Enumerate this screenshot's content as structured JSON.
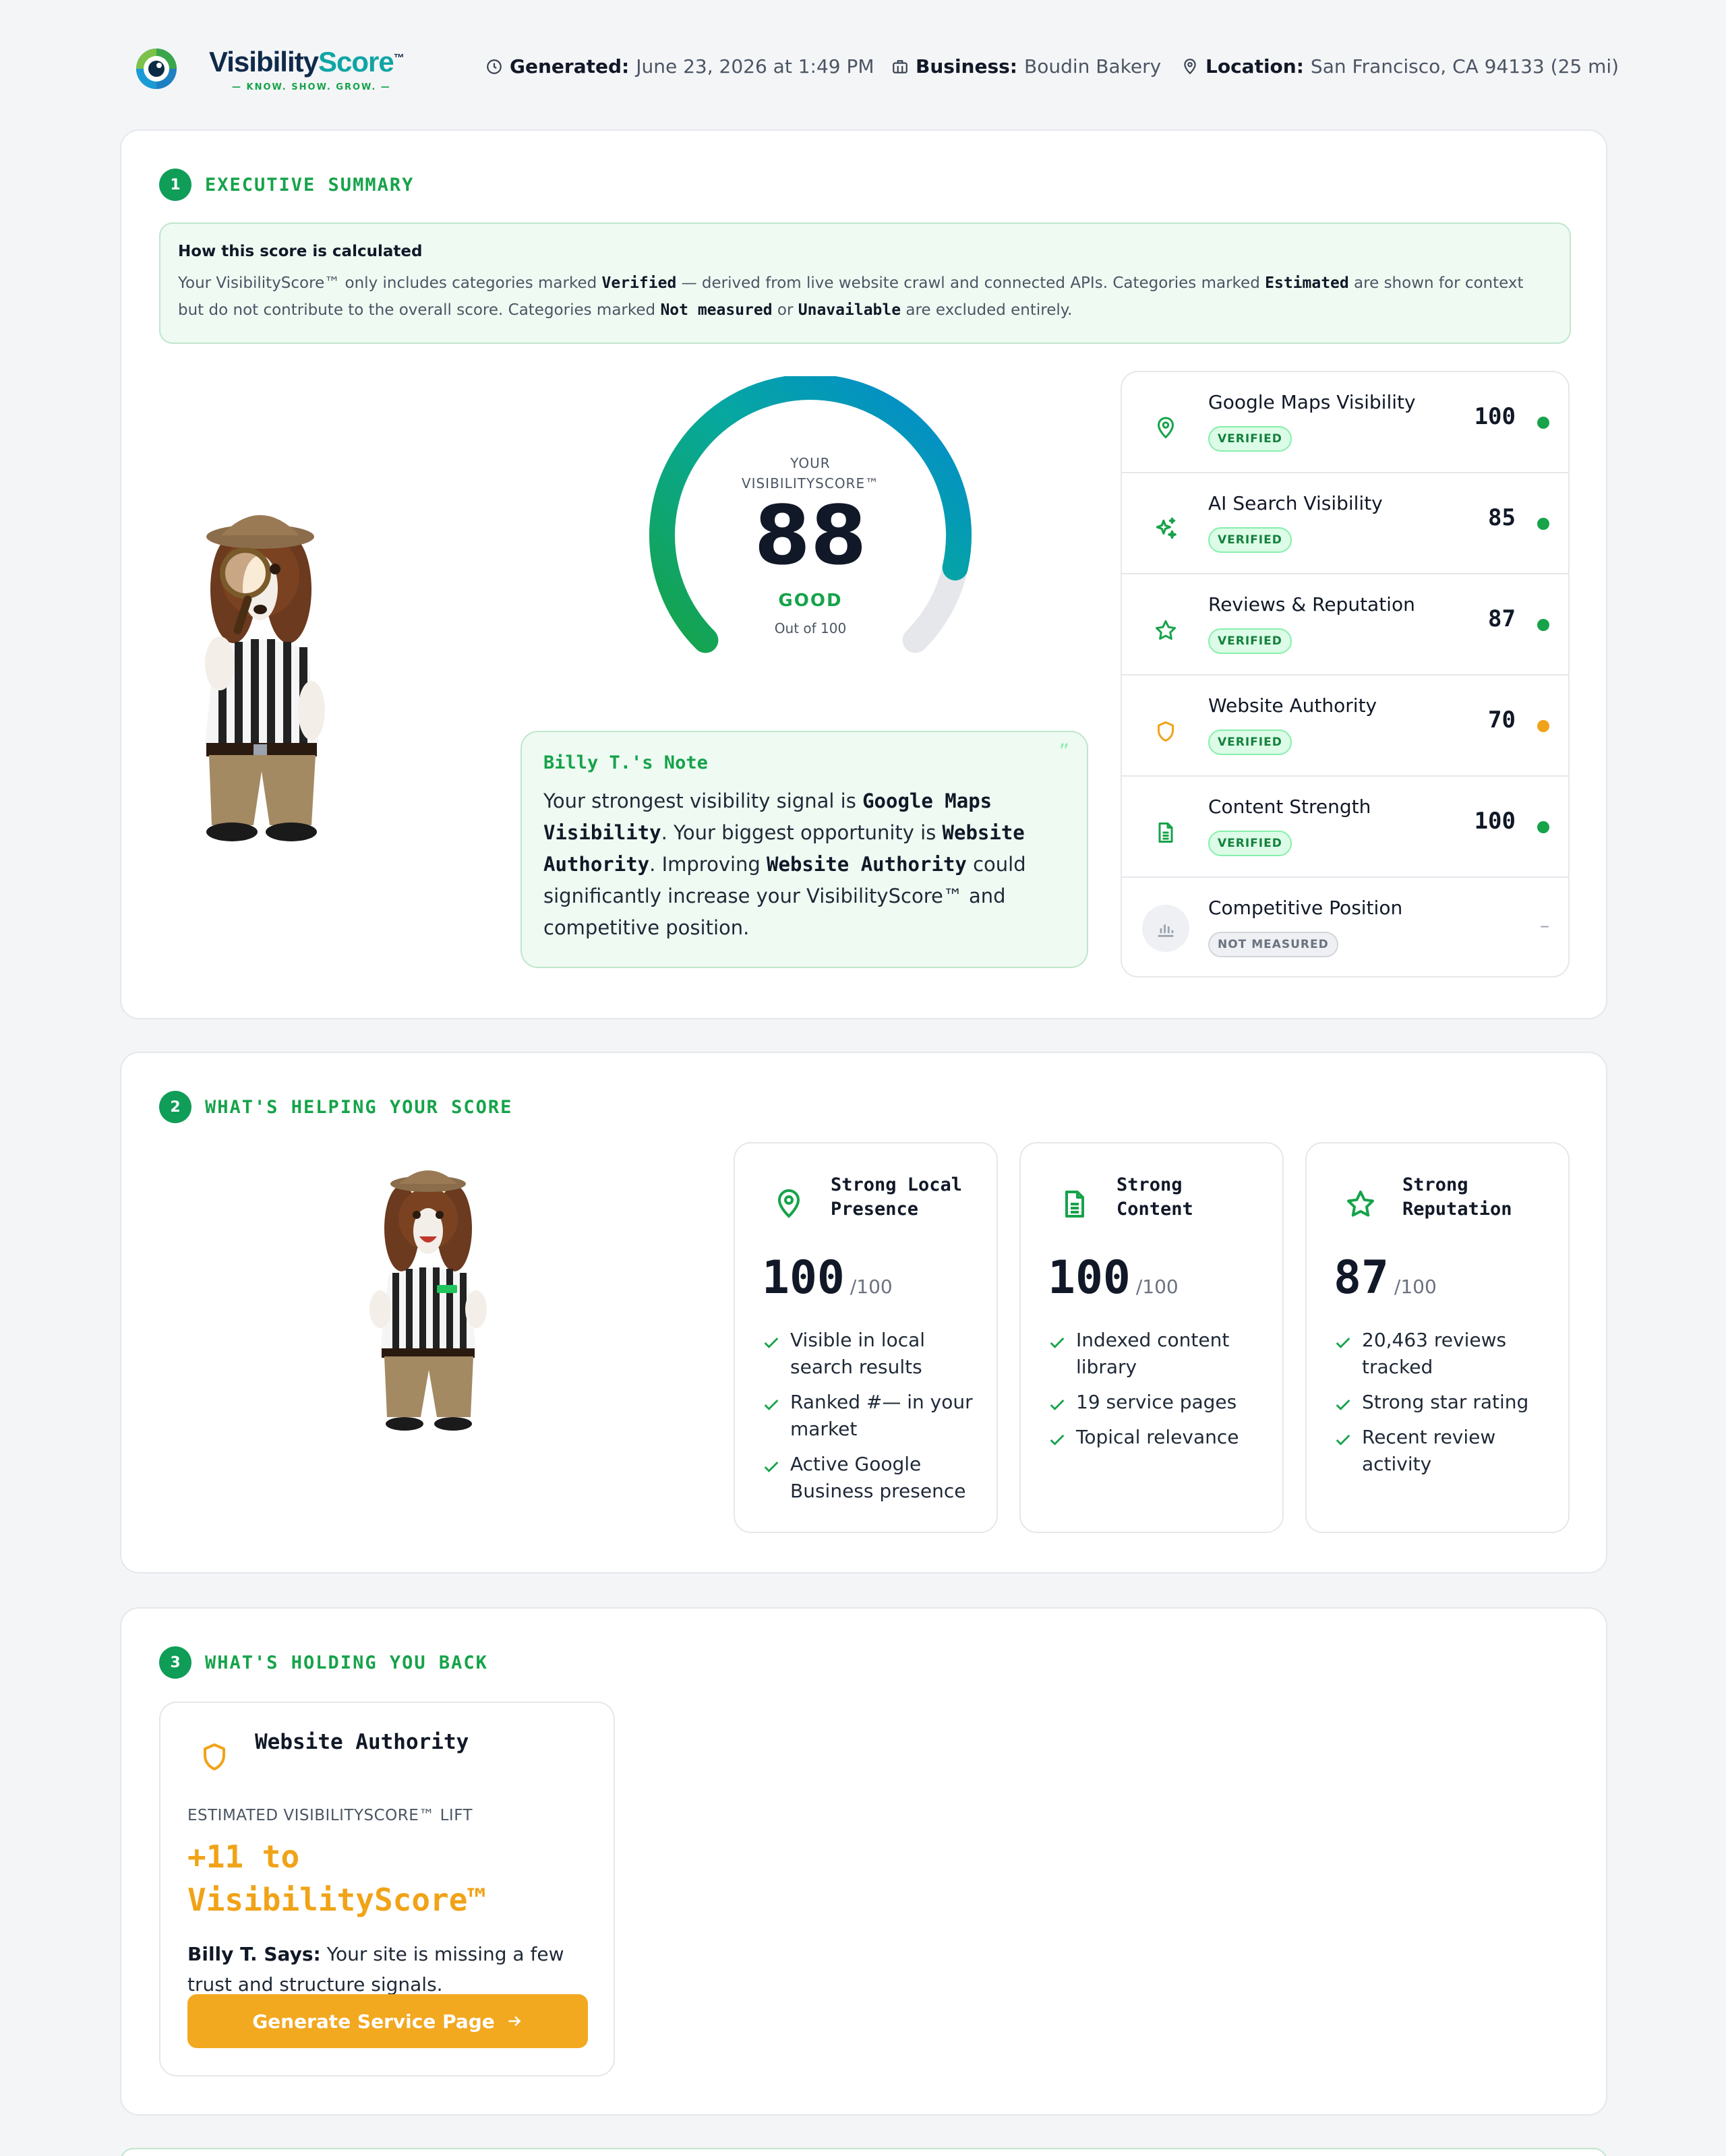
{
  "header": {
    "brand": {
      "name_pre": "Visibility",
      "name_accent": "Score",
      "tm": "™",
      "tagline": "— KNOW. SHOW. GROW. —"
    },
    "generated_label": "Generated:",
    "generated_value": "June 23, 2026 at 1:49 PM",
    "business_label": "Business:",
    "business_value": "Boudin Bakery",
    "location_label": "Location:",
    "location_value": "San Francisco, CA 94133 (25 mi)"
  },
  "summary": {
    "num": "1",
    "title": "EXECUTIVE SUMMARY",
    "calc_title": "How this score is calculated",
    "calc_p1": "Your VisibilityScore™ only includes categories marked ",
    "calc_k1": "Verified",
    "calc_p2": " — derived from live website crawl and connected APIs. Categories marked ",
    "calc_k2": "Estimated",
    "calc_p3": " are shown for context but do not contribute to the overall score. Categories marked ",
    "calc_k3": "Not measured",
    "calc_p4": " or ",
    "calc_k4": "Unavailable",
    "calc_p5": " are excluded entirely.",
    "gauge": {
      "label_line1": "YOUR",
      "label_line2": "VISIBILITYSCORE™",
      "score": "88",
      "score_value": 88,
      "max": 100,
      "rating": "GOOD",
      "out_of": "Out of 100"
    },
    "note": {
      "title": "Billy T.'s Note",
      "t1": "Your strongest visibility signal is ",
      "k1": "Google Maps Visibility",
      "t2": ". Your biggest opportunity is ",
      "k2": "Website Authority",
      "t3": ". Improving ",
      "k3": "Website Authority",
      "t4": " could significantly increase your VisibilityScore™ and competitive position.",
      "quote": "”"
    },
    "categories": [
      {
        "name": "Google Maps Visibility",
        "badge": "VERIFIED",
        "value": "100",
        "icon": "map-pin-icon",
        "dot": "#16a34a"
      },
      {
        "name": "AI Search Visibility",
        "badge": "VERIFIED",
        "value": "85",
        "icon": "sparkles-icon",
        "dot": "#16a34a"
      },
      {
        "name": "Reviews & Reputation",
        "badge": "VERIFIED",
        "value": "87",
        "icon": "star-icon",
        "dot": "#16a34a"
      },
      {
        "name": "Website Authority",
        "badge": "VERIFIED",
        "value": "70",
        "icon": "shield-icon",
        "dot": "#f0a317"
      },
      {
        "name": "Content Strength",
        "badge": "VERIFIED",
        "value": "100",
        "icon": "document-icon",
        "dot": "#16a34a"
      },
      {
        "name": "Competitive Position",
        "badge": "NOT MEASURED",
        "value": "–",
        "icon": "bar-chart-icon",
        "dot": ""
      }
    ]
  },
  "helping": {
    "num": "2",
    "title": "WHAT'S HELPING YOUR SCORE",
    "cards": [
      {
        "title_l1": "Strong Local",
        "title_l2": "Presence",
        "score": "100",
        "of": "/100",
        "icon": "map-pin-icon",
        "items": [
          "Visible in local search results",
          "Ranked #— in your market",
          "Active Google Business presence"
        ]
      },
      {
        "title_l1": "Strong",
        "title_l2": "Content",
        "score": "100",
        "of": "/100",
        "icon": "document-icon",
        "items": [
          "Indexed content library",
          "19 service pages",
          "Topical relevance"
        ]
      },
      {
        "title_l1": "Strong",
        "title_l2": "Reputation",
        "score": "87",
        "of": "/100",
        "icon": "star-icon",
        "items": [
          "20,463 reviews tracked",
          "Strong star rating",
          "Recent review activity"
        ]
      }
    ]
  },
  "holding": {
    "num": "3",
    "title": "WHAT'S HOLDING YOU BACK",
    "card": {
      "title": "Website Authority",
      "icon": "shield-icon",
      "est_label": "ESTIMATED VISIBILITYSCORE™ LIFT",
      "lift": "+11 to VisibilityScore™",
      "says_label": "Billy T. Says:",
      "says_text": " Your site is missing a few trust and structure signals.",
      "button": "Generate Service Page",
      "button_icon": "arrow-right-icon"
    }
  },
  "colors": {
    "green": "#16a34a",
    "amber": "#f0a317",
    "blue": "#0288d1",
    "bg": "#f4f5f7"
  }
}
